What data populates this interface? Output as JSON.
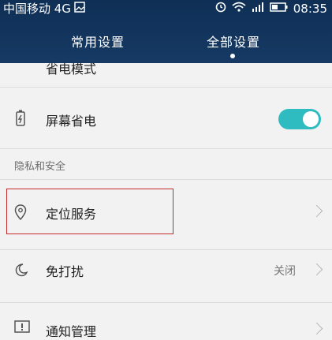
{
  "status_bar": {
    "carrier": "中国移动 4G",
    "time": "08:35",
    "icons": [
      "image-icon",
      "alarm-icon",
      "wifi-icon",
      "signal-icon",
      "battery-icon"
    ]
  },
  "tabs": [
    {
      "label": "常用设置",
      "selected": false
    },
    {
      "label": "全部设置",
      "selected": true
    }
  ],
  "rows": {
    "partial_label": "省电模式",
    "screen_power": {
      "label": "屏幕省电",
      "toggle_on": true
    },
    "section_privacy": "隐私和安全",
    "location": {
      "label": "定位服务"
    },
    "dnd": {
      "label": "免打扰",
      "value": "关闭"
    },
    "notifications": {
      "label": "通知管理"
    }
  },
  "colors": {
    "header_bg": "#163a64",
    "toggle_on": "#2fbcc1",
    "highlight_border": "#c62b2b"
  }
}
